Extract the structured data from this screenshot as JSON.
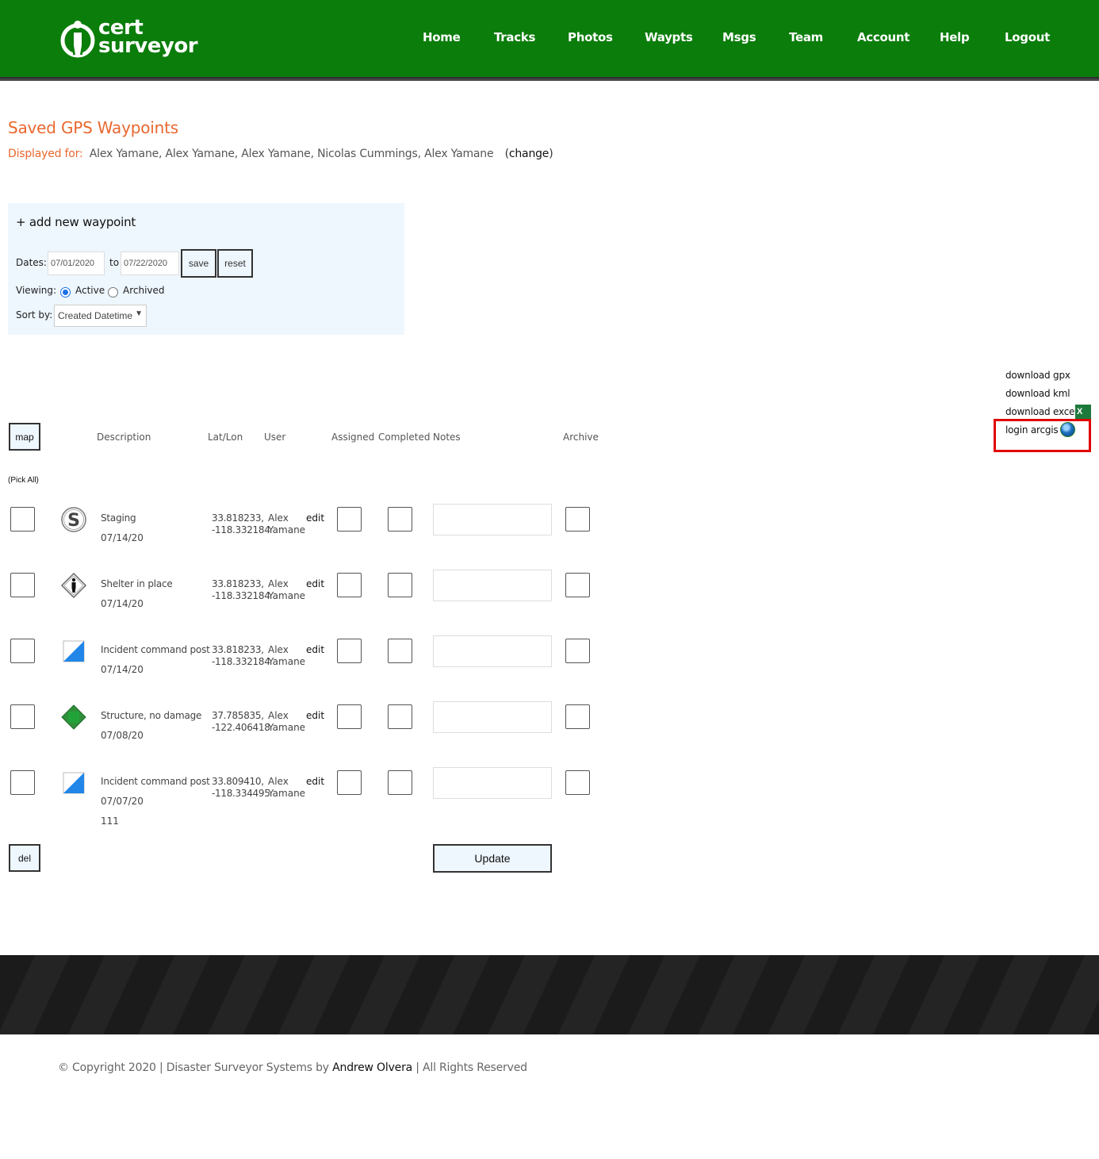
{
  "brand": {
    "line1": "cert",
    "line2": "surveyor"
  },
  "nav": [
    "Home",
    "Tracks",
    "Photos",
    "Waypts",
    "Msgs",
    "Team",
    "Account",
    "Help",
    "Logout"
  ],
  "page": {
    "title": "Saved GPS Waypoints",
    "displayed_label": "Displayed for:",
    "displayed_names": "Alex Yamane, Alex Yamane, Alex Yamane, Nicolas Cummings, Alex Yamane",
    "change_open": "(",
    "change_link": "change",
    "change_close": ")"
  },
  "filters": {
    "add_label": "+ add new waypoint",
    "dates_label": "Dates:",
    "date_from": "07/01/2020",
    "to_label": "to",
    "date_to": "07/22/2020",
    "save": "save",
    "reset": "reset",
    "viewing_label": "Viewing:",
    "viewing_options": [
      "Active",
      "Archived"
    ],
    "viewing_selected": "Active",
    "sort_label": "Sort by:",
    "sort_value": "Created Datetime"
  },
  "downloads": {
    "gpx": "download gpx",
    "kml": "download kml",
    "excel": "download excel",
    "excel_icon_text": "X",
    "arcgis": "login arcgis"
  },
  "table": {
    "map_button": "map",
    "headers": {
      "description": "Description",
      "latlon": "Lat/Lon",
      "user": "User",
      "assigned": "Assigned",
      "completed": "Completed",
      "notes": "Notes",
      "archive": "Archive"
    },
    "pick_all": "(Pick All)",
    "edit_label": "edit",
    "rows": [
      {
        "icon": "staging-icon",
        "description": "Staging",
        "date": "07/14/20",
        "extra": "",
        "lat": "33.818233,",
        "lon": "-118.332184",
        "user_first": "Alex",
        "user_last": "Yamane"
      },
      {
        "icon": "shelter-icon",
        "description": "Shelter in place",
        "date": "07/14/20",
        "extra": "",
        "lat": "33.818233,",
        "lon": "-118.332184",
        "user_first": "Alex",
        "user_last": "Yamane"
      },
      {
        "icon": "command-post-icon",
        "description": "Incident command post",
        "date": "07/14/20",
        "extra": "",
        "lat": "33.818233,",
        "lon": "-118.332184",
        "user_first": "Alex",
        "user_last": "Yamane"
      },
      {
        "icon": "structure-no-damage-icon",
        "description": "Structure, no damage",
        "date": "07/08/20",
        "extra": "",
        "lat": "37.785835,",
        "lon": "-122.406418",
        "user_first": "Alex",
        "user_last": "Yamane"
      },
      {
        "icon": "command-post-icon",
        "description": "Incident command post",
        "date": "07/07/20",
        "extra": "111",
        "lat": "33.809410,",
        "lon": "-118.334495",
        "user_first": "Alex",
        "user_last": "Yamane"
      }
    ],
    "del_button": "del",
    "update_button": "Update"
  },
  "footer": {
    "prefix": "© Copyright 2020 | Disaster Surveyor Systems by ",
    "author": "Andrew Olvera",
    "suffix": " | All Rights Reserved"
  },
  "colors": {
    "header_green": "#0b7d0b",
    "title_orange": "#e8682f",
    "panel_blue": "#eef6fe",
    "highlight_red": "#e00000"
  }
}
